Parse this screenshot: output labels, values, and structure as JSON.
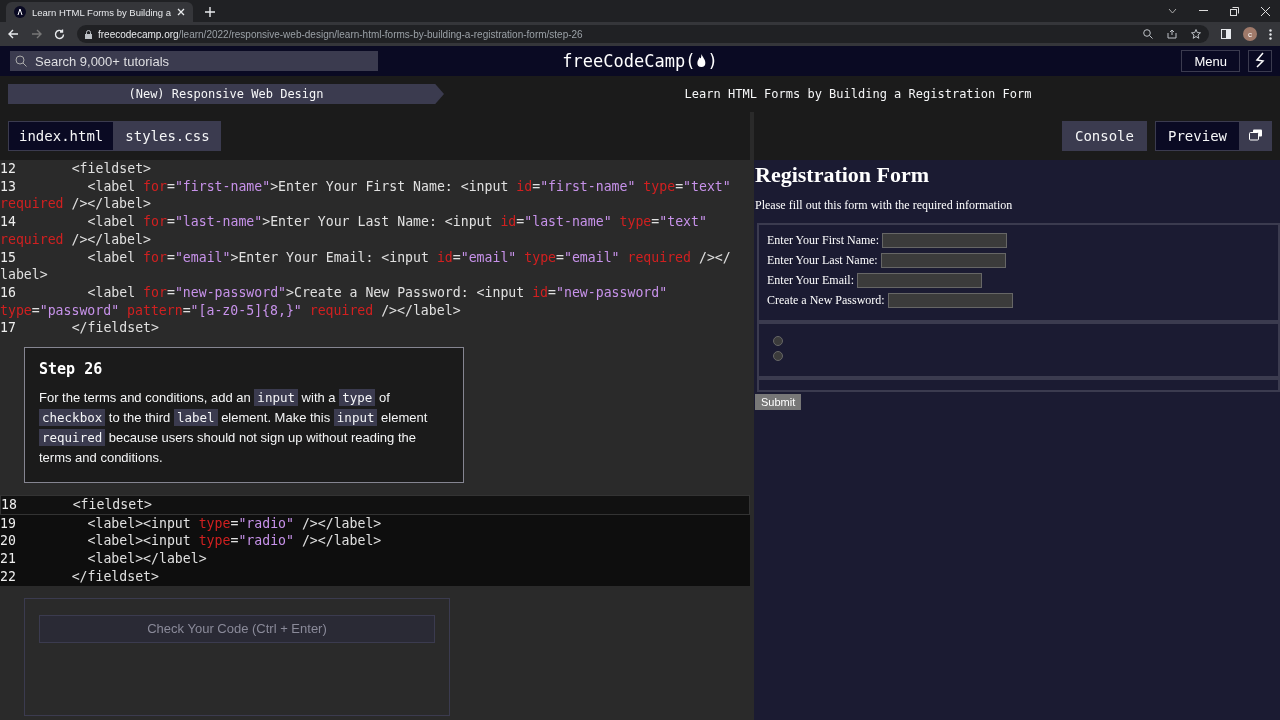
{
  "browser": {
    "tab_title": "Learn HTML Forms by Building a",
    "url_domain": "freecodecamp.org",
    "url_path": "/learn/2022/responsive-web-design/learn-html-forms-by-building-a-registration-form/step-26",
    "avatar_letter": "c"
  },
  "nav": {
    "search_placeholder": "Search 9,000+ tutorials",
    "logo_start": "freeCodeCamp(",
    "logo_end": ")",
    "menu": "Menu"
  },
  "breadcrumb": {
    "superblock": "(New) Responsive Web Design",
    "block": "Learn HTML Forms by Building a Registration Form"
  },
  "file_tabs": [
    {
      "label": "index.html",
      "selected": true
    },
    {
      "label": "styles.css",
      "selected": false
    }
  ],
  "preview_tabs": [
    {
      "label": "Console",
      "selected": false
    },
    {
      "label": "Preview",
      "selected": true
    }
  ],
  "code_top": [
    {
      "number": "12",
      "tokens": [
        {
          "kind": "tag",
          "text": "      <fieldset>"
        }
      ]
    },
    {
      "number": "13",
      "tokens": [
        {
          "kind": "tag",
          "text": "        <label "
        },
        {
          "kind": "attr",
          "text": "for"
        },
        {
          "kind": "tag",
          "text": "="
        },
        {
          "kind": "string",
          "text": "\"first-name\""
        },
        {
          "kind": "tag",
          "text": ">Enter Your First Name: <input "
        },
        {
          "kind": "attr",
          "text": "id"
        },
        {
          "kind": "tag",
          "text": "="
        },
        {
          "kind": "string",
          "text": "\"first-name\""
        },
        {
          "kind": "attr",
          "text": " type"
        },
        {
          "kind": "tag",
          "text": "="
        },
        {
          "kind": "string",
          "text": "\"text\""
        },
        {
          "kind": "break"
        },
        {
          "kind": "attr",
          "text": "required"
        },
        {
          "kind": "tag",
          "text": " /></label>"
        }
      ]
    },
    {
      "number": "14",
      "tokens": [
        {
          "kind": "tag",
          "text": "        <label "
        },
        {
          "kind": "attr",
          "text": "for"
        },
        {
          "kind": "tag",
          "text": "="
        },
        {
          "kind": "string",
          "text": "\"last-name\""
        },
        {
          "kind": "tag",
          "text": ">Enter Your Last Name: <input "
        },
        {
          "kind": "attr",
          "text": "id"
        },
        {
          "kind": "tag",
          "text": "="
        },
        {
          "kind": "string",
          "text": "\"last-name\""
        },
        {
          "kind": "attr",
          "text": " type"
        },
        {
          "kind": "tag",
          "text": "="
        },
        {
          "kind": "string",
          "text": "\"text\""
        },
        {
          "kind": "break"
        },
        {
          "kind": "attr",
          "text": "required"
        },
        {
          "kind": "tag",
          "text": " /></label>"
        }
      ]
    },
    {
      "number": "15",
      "tokens": [
        {
          "kind": "tag",
          "text": "        <label "
        },
        {
          "kind": "attr",
          "text": "for"
        },
        {
          "kind": "tag",
          "text": "="
        },
        {
          "kind": "string",
          "text": "\"email\""
        },
        {
          "kind": "tag",
          "text": ">Enter Your Email: <input "
        },
        {
          "kind": "attr",
          "text": "id"
        },
        {
          "kind": "tag",
          "text": "="
        },
        {
          "kind": "string",
          "text": "\"email\""
        },
        {
          "kind": "attr",
          "text": " type"
        },
        {
          "kind": "tag",
          "text": "="
        },
        {
          "kind": "string",
          "text": "\"email\""
        },
        {
          "kind": "attr",
          "text": " required"
        },
        {
          "kind": "tag",
          "text": " /></"
        },
        {
          "kind": "break"
        },
        {
          "kind": "tag",
          "text": "label>"
        }
      ]
    },
    {
      "number": "16",
      "tokens": [
        {
          "kind": "tag",
          "text": "        <label "
        },
        {
          "kind": "attr",
          "text": "for"
        },
        {
          "kind": "tag",
          "text": "="
        },
        {
          "kind": "string",
          "text": "\"new-password\""
        },
        {
          "kind": "tag",
          "text": ">Create a New Password: <input "
        },
        {
          "kind": "attr",
          "text": "id"
        },
        {
          "kind": "tag",
          "text": "="
        },
        {
          "kind": "string",
          "text": "\"new-password\""
        },
        {
          "kind": "break"
        },
        {
          "kind": "attr",
          "text": "type"
        },
        {
          "kind": "tag",
          "text": "="
        },
        {
          "kind": "string",
          "text": "\"password\""
        },
        {
          "kind": "attr",
          "text": " pattern"
        },
        {
          "kind": "tag",
          "text": "="
        },
        {
          "kind": "string",
          "text": "\"[a-z0-5]{8,}\""
        },
        {
          "kind": "attr",
          "text": " required"
        },
        {
          "kind": "tag",
          "text": " /></label>"
        }
      ]
    },
    {
      "number": "17",
      "tokens": [
        {
          "kind": "tag",
          "text": "      </fieldset>"
        }
      ]
    }
  ],
  "step": {
    "title": "Step 26",
    "paragraph": [
      {
        "kind": "text",
        "text": "For the terms and conditions, add an "
      },
      {
        "kind": "code",
        "text": "input"
      },
      {
        "kind": "text",
        "text": " with a "
      },
      {
        "kind": "code",
        "text": "type"
      },
      {
        "kind": "text",
        "text": " of "
      },
      {
        "kind": "code",
        "text": "checkbox"
      },
      {
        "kind": "text",
        "text": " to the third "
      },
      {
        "kind": "code",
        "text": "label"
      },
      {
        "kind": "text",
        "text": " element. Make this "
      },
      {
        "kind": "code",
        "text": "input"
      },
      {
        "kind": "text",
        "text": " element "
      },
      {
        "kind": "code",
        "text": "required"
      },
      {
        "kind": "text",
        "text": " because users should not sign up without reading the terms and conditions."
      }
    ]
  },
  "code_editable": [
    {
      "number": "18",
      "active": true,
      "tokens": [
        {
          "kind": "tag",
          "text": "      <fieldset>"
        }
      ]
    },
    {
      "number": "19",
      "active": false,
      "tokens": [
        {
          "kind": "tag",
          "text": "        <label><input "
        },
        {
          "kind": "attr",
          "text": "type"
        },
        {
          "kind": "tag",
          "text": "="
        },
        {
          "kind": "string",
          "text": "\"radio\""
        },
        {
          "kind": "tag",
          "text": " /></label>"
        }
      ]
    },
    {
      "number": "20",
      "active": false,
      "tokens": [
        {
          "kind": "tag",
          "text": "        <label><input "
        },
        {
          "kind": "attr",
          "text": "type"
        },
        {
          "kind": "tag",
          "text": "="
        },
        {
          "kind": "string",
          "text": "\"radio\""
        },
        {
          "kind": "tag",
          "text": " /></label>"
        }
      ]
    },
    {
      "number": "21",
      "active": false,
      "tokens": [
        {
          "kind": "tag",
          "text": "        <label></label>"
        }
      ]
    },
    {
      "number": "22",
      "active": false,
      "tokens": [
        {
          "kind": "tag",
          "text": "      </fieldset>"
        }
      ]
    }
  ],
  "check_button": {
    "label": "Check Your Code (Ctrl + Enter)",
    "disabled": true
  },
  "preview": {
    "title": "Registration Form",
    "intro": "Please fill out this form with the required information",
    "fields": [
      {
        "label": "Enter Your First Name:"
      },
      {
        "label": "Enter Your Last Name:"
      },
      {
        "label": "Enter Your Email:"
      },
      {
        "label": "Create a New Password:"
      }
    ],
    "radios": [
      {
        "checked": false
      },
      {
        "checked": false
      }
    ],
    "submit": "Submit"
  }
}
